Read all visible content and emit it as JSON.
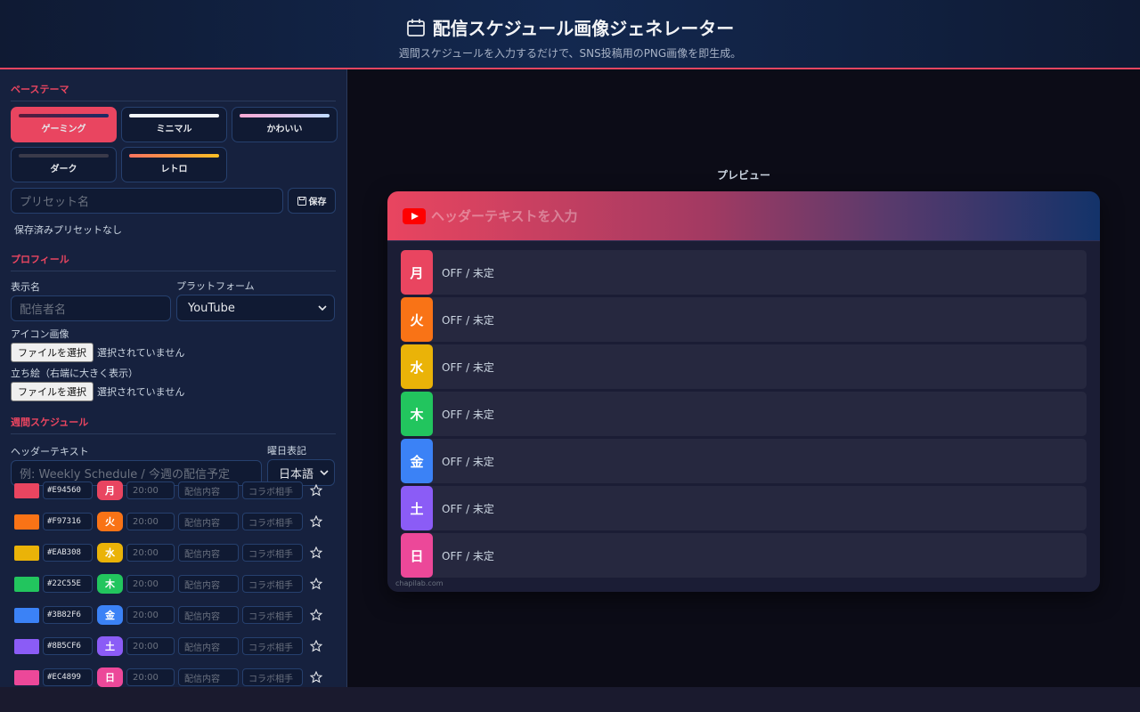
{
  "app": {
    "title": "配信スケジュール画像ジェネレーター",
    "subtitle": "週間スケジュールを入力するだけで、SNS投稿用のPNG画像を即生成。"
  },
  "theme": {
    "section": "ベーステーマ",
    "items": [
      {
        "label": "ゲーミング",
        "active": true
      },
      {
        "label": "ミニマル",
        "active": false
      },
      {
        "label": "かわいい",
        "active": false
      },
      {
        "label": "ダーク",
        "active": false
      },
      {
        "label": "レトロ",
        "active": false
      }
    ],
    "preset_placeholder": "プリセット名",
    "save_label": "保存",
    "no_presets": "保存済みプリセットなし"
  },
  "profile": {
    "section": "プロフィール",
    "display_name_label": "表示名",
    "display_name_placeholder": "配信者名",
    "platform_label": "プラットフォーム",
    "platform_value": "YouTube",
    "icon_label": "アイコン画像",
    "standing_label": "立ち絵（右端に大きく表示）",
    "file_button": "ファイルを選択",
    "file_status": "選択されていません"
  },
  "schedule": {
    "section": "週間スケジュール",
    "header_label": "ヘッダーテキスト",
    "header_placeholder": "例: Weekly Schedule / 今週の配信予定",
    "dayfmt_label": "曜日表記",
    "dayfmt_value": "日本語",
    "time_placeholder": "20:00",
    "content_placeholder": "配信内容",
    "collab_placeholder": "コラボ相手",
    "days": [
      {
        "day": "月",
        "color": "#E94560"
      },
      {
        "day": "火",
        "color": "#F97316"
      },
      {
        "day": "水",
        "color": "#EAB308"
      },
      {
        "day": "木",
        "color": "#22C55E"
      },
      {
        "day": "金",
        "color": "#3B82F6"
      },
      {
        "day": "土",
        "color": "#8B5CF6"
      },
      {
        "day": "日",
        "color": "#EC4899"
      }
    ]
  },
  "preview": {
    "label": "プレビュー",
    "header_placeholder": "ヘッダーテキストを入力",
    "off_text": "OFF / 未定",
    "watermark": "chapilab.com"
  },
  "colors": {
    "accent": "#e94560",
    "youtube": "#ff0000"
  }
}
